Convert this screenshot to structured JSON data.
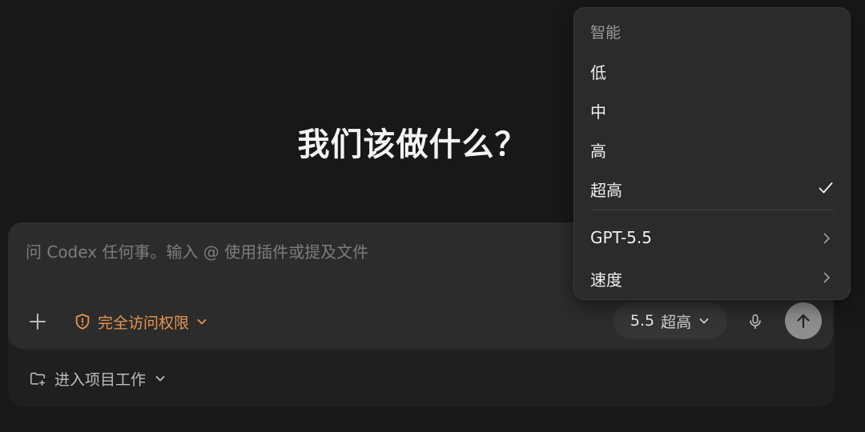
{
  "headline": "我们该做什么？",
  "composer": {
    "placeholder": "问 Codex 任何事。输入 @ 使用插件或提及文件",
    "access_label": "完全访问权限",
    "model_version": "5.5",
    "model_level": "超高"
  },
  "project": {
    "label": "进入项目工作"
  },
  "menu": {
    "heading": "智能",
    "levels": [
      {
        "label": "低",
        "checked": false
      },
      {
        "label": "中",
        "checked": false
      },
      {
        "label": "高",
        "checked": false
      },
      {
        "label": "超高",
        "checked": true
      }
    ],
    "submenus": [
      {
        "label": "GPT-5.5"
      },
      {
        "label": "速度"
      }
    ]
  },
  "colors": {
    "background": "#181818",
    "composer": "#2c2c2c",
    "menu": "#2b2b2b",
    "accent_orange": "#e8944f",
    "send_button": "#8e8e8e"
  },
  "icons": [
    "plus-icon",
    "shield-alert-icon",
    "chevron-down-icon",
    "microphone-icon",
    "arrow-up-icon",
    "folder-plus-icon",
    "checkmark-icon",
    "chevron-right-icon"
  ]
}
